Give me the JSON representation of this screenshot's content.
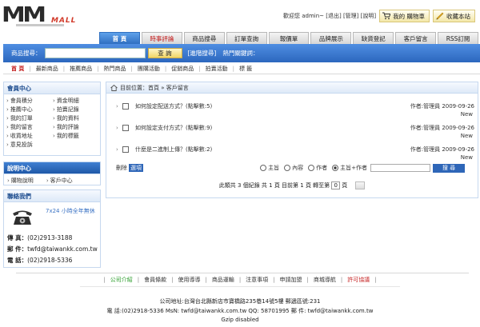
{
  "logo": {
    "main": "MM",
    "sub": "MALL"
  },
  "topbar": {
    "welcome": "歡迎您 admin~ [退出] [管理] [說明]",
    "cart_label": "我的 購物車",
    "favorite_label": "收藏本站"
  },
  "nav": {
    "tabs": [
      {
        "label": "首 頁",
        "active": true,
        "red": false
      },
      {
        "label": "時事評論",
        "active": false,
        "red": true
      },
      {
        "label": "商品搜尋",
        "active": false,
        "red": false
      },
      {
        "label": "訂單查詢",
        "active": false,
        "red": false
      },
      {
        "label": "報價單",
        "active": false,
        "red": false
      },
      {
        "label": "品牌展示",
        "active": false,
        "red": false
      },
      {
        "label": "缺貨登記",
        "active": false,
        "red": false
      },
      {
        "label": "客戶留言",
        "active": false,
        "red": false
      },
      {
        "label": "RSS訂閱",
        "active": false,
        "red": false
      }
    ]
  },
  "search": {
    "label": "商品搜尋：",
    "value": "",
    "button": "查 詢",
    "advanced": "[進階搜尋]",
    "hot": "熱門關鍵詞："
  },
  "subnav": {
    "items": [
      "首 頁",
      "最新商品",
      "推薦商品",
      "熱門商品",
      "團購活動",
      "促銷商品",
      "拍賣活動",
      "標 籤"
    ]
  },
  "member": {
    "title": "會員中心",
    "links": [
      "會員積分",
      "資金明細",
      "推薦中心",
      "拍賣記錄",
      "我的訂單",
      "我的資料",
      "我的留言",
      "我的評論",
      "收貨地址",
      "我的標籤",
      "意見投訴"
    ]
  },
  "help": {
    "title": "說明中心",
    "links": [
      "購物說明",
      "客戶中心"
    ]
  },
  "contact": {
    "title": "聯絡我們",
    "hours": "7x24 小時全年無休",
    "tel_label": "傳 真：",
    "tel_value": "(02)2913-3188",
    "mail_label": "郵 件：",
    "mail_value": "twfd@taiwankk.com.tw",
    "phone_label": "電 話：",
    "phone_value": "(02)2918-5336"
  },
  "main": {
    "breadcrumb": "目前位置：首頁 » 客戶留言",
    "messages": [
      {
        "question": "如何設定配送方式？(點擊數:5)",
        "meta": "作者:管理員 2009-09-26",
        "new": "New"
      },
      {
        "question": "如何設定支付方式？(點擊數:9)",
        "meta": "作者:管理員 2009-09-26",
        "new": "New"
      },
      {
        "question": "什麼是二進制上傳？(點擊數:2)",
        "meta": "作者:管理員 2009-09-26",
        "new": "New"
      }
    ],
    "delete_label": "刪除",
    "select_label": "選項",
    "radio_options": [
      "主旨",
      "內容",
      "作者",
      "主旨+作者"
    ],
    "radio_selected": 3,
    "search_button": "搜 尋",
    "pager_text": "此類共 3 個紀錄 共 1 頁 目前第 1 頁 轉至第",
    "pager_page": "0",
    "pager_suffix": "頁"
  },
  "footer": {
    "links": [
      {
        "label": "公司介紹",
        "style": "g"
      },
      {
        "label": "會員條款",
        "style": ""
      },
      {
        "label": "使用導導",
        "style": ""
      },
      {
        "label": "商品運輸",
        "style": ""
      },
      {
        "label": "注意事項",
        "style": ""
      },
      {
        "label": "申請加盟",
        "style": ""
      },
      {
        "label": "商城導航",
        "style": ""
      },
      {
        "label": "許可協議",
        "style": "r"
      }
    ],
    "address": "公司地址:台灣台北縣新店市寶橋路235巷14號5樓 郵遞區號:231",
    "contact": "電 話:(02)2918-5336 MsN: twfd@taiwankk.com.tw QQ: 58701995 郵 件: twfd@taiwankk.com.tw",
    "gzip": "Gzip disabled"
  }
}
